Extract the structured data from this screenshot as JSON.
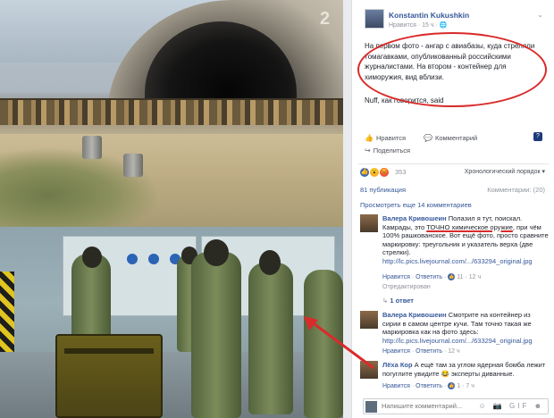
{
  "photos": {
    "hangar_number": "2"
  },
  "post": {
    "author": "Konstantin Kukushkin",
    "meta": "Нравится · 15 ч · 🌐",
    "text": "На первом фото - ангар с авиабазы, куда стреляли томагавками, опубликованный российскими журналистами. На втором - контейнер для химоружия, вид вблизи.",
    "text2": "Nuff, как говорится, said",
    "chevron": "⌄"
  },
  "actions": {
    "like": "Нравится",
    "comment": "Комментарий",
    "share": "Поделиться",
    "badge": "?"
  },
  "reactions": {
    "count": "353",
    "order": "Хронологический порядок ▾"
  },
  "stats": {
    "shares": "81 публикация",
    "comments": "Комментарии: (20)"
  },
  "more_comments": "Просмотреть еще 14 комментариев",
  "comments": [
    {
      "name": "Валера Кривошеин",
      "text_before": "Полазил я тут, поискал. Камрады, это ",
      "text_highlight": "ТОЧНО химическое оружие",
      "text_after": ", при чём 100% рашкованское. Вот ещё фото, просто сравните маркировку: треугольник и указатель верха (две стрелки).",
      "link": "http://lc.pics.livejournal.com/.../633294_original.jpg",
      "like": "Нравится",
      "reply": "Ответить",
      "likes": "11",
      "time": "12 ч",
      "edited": "Отредактирован"
    },
    {
      "name": "Валера Кривошеин",
      "text": "Смотрите на контейнер из сирии в самом центре кучи. Там точно такая же маркировка как на фото здесь:",
      "link": "http://lc.pics.livejournal.com/.../633294_original.jpg",
      "like": "Нравится",
      "reply": "Ответить",
      "time": "12 ч"
    },
    {
      "name": "Лёха Кор",
      "text": "А ещё там за углом ядерная бомба лежит погуглите увидите 😂 эксперты диванные.",
      "like": "Нравится",
      "reply": "Ответить",
      "likes": "1",
      "time": "7 ч"
    }
  ],
  "reply_line": {
    "label": "1 ответ"
  },
  "comment_input": {
    "placeholder": "Напишите комментарий...",
    "icons": "☺ 📷 GIF ☻"
  },
  "colors": {
    "link": "#365899",
    "annotation_red": "#d92b2b"
  }
}
